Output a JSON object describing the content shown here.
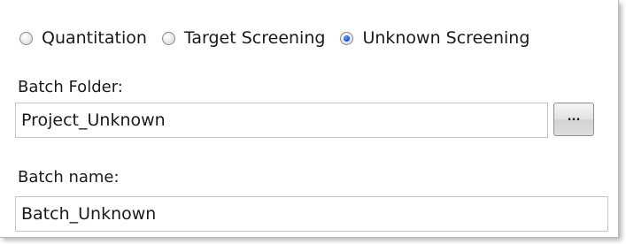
{
  "mode": {
    "options": [
      {
        "label": "Quantitation",
        "checked": false
      },
      {
        "label": "Target Screening",
        "checked": false
      },
      {
        "label": "Unknown Screening",
        "checked": true
      }
    ]
  },
  "batch_folder": {
    "label": "Batch Folder:",
    "value": "Project_Unknown",
    "browse_label": "..."
  },
  "batch_name": {
    "label": "Batch name:",
    "value": "Batch_Unknown"
  }
}
